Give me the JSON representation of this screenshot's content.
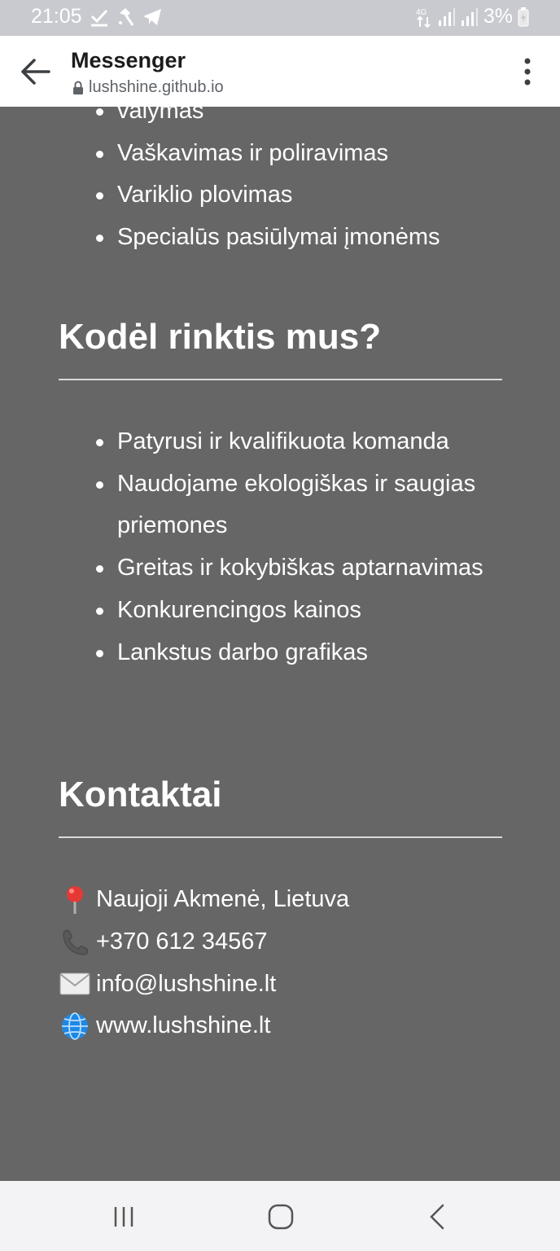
{
  "status_bar": {
    "time": "21:05",
    "network": "4G",
    "battery": "3%"
  },
  "app_bar": {
    "title": "Messenger",
    "url": "lushshine.github.io"
  },
  "services": {
    "items": [
      "valymas",
      "Vaškavimas ir poliravimas",
      "Variklio plovimas",
      "Specialūs pasiūlymai įmonėms"
    ]
  },
  "why_us": {
    "title": "Kodėl rinktis mus?",
    "items": [
      "Patyrusi ir kvalifikuota komanda",
      "Naudojame ekologiškas ir saugias priemones",
      "Greitas ir kokybiškas aptarnavimas",
      "Konkurencingos kainos",
      "Lankstus darbo grafikas"
    ]
  },
  "contacts": {
    "title": "Kontaktai",
    "address": "Naujoji Akmenė, Lietuva",
    "phone": "+370 612 34567",
    "email": "info@lushshine.lt",
    "website": "www.lushshine.lt"
  },
  "icons": {
    "back": "arrow-back-icon",
    "lock": "lock-icon",
    "menu": "more-vert-icon",
    "pin": "pin-icon",
    "phone": "phone-icon",
    "email": "envelope-icon",
    "globe": "globe-icon"
  },
  "colors": {
    "page_background": "#666666",
    "status_bar": "#c8cacf",
    "text": "#ffffff",
    "pin": "#e53935",
    "globe": "#1e88e5"
  }
}
